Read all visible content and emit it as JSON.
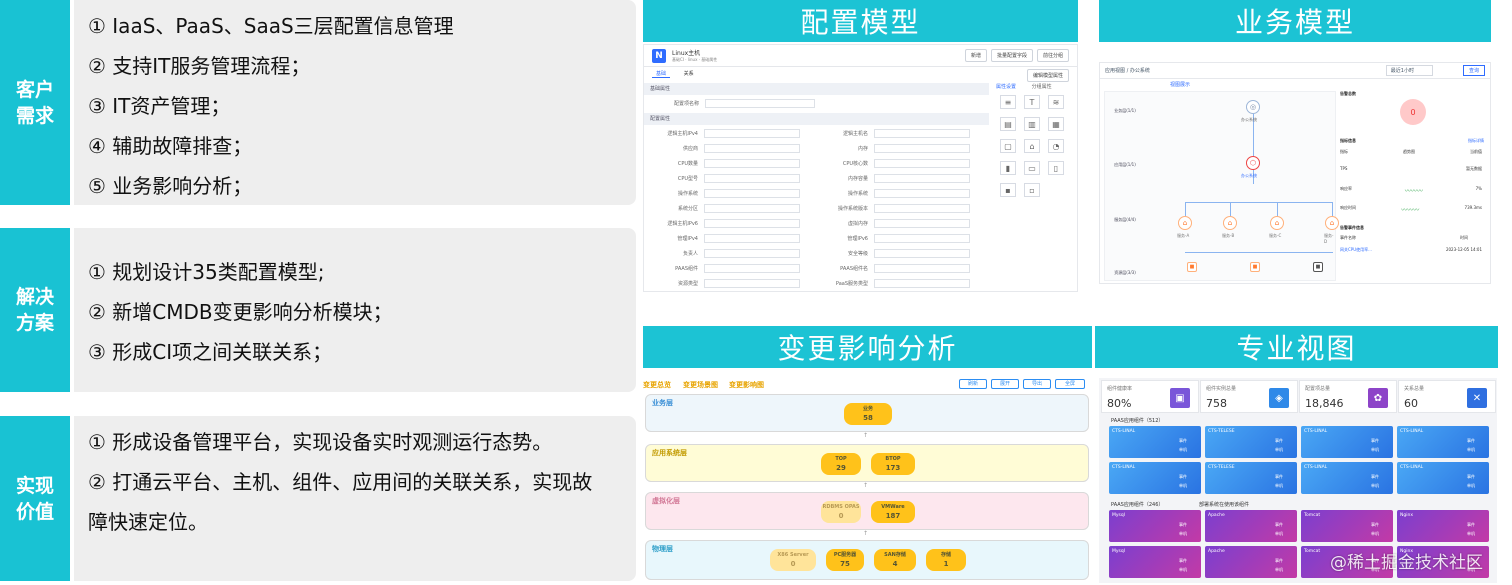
{
  "blocks": [
    {
      "label": "客户需求",
      "items": [
        "① IaaS、PaaS、SaaS三层配置信息管理",
        "② 支持IT服务管理流程；",
        "③ IT资产管理；",
        "④ 辅助故障排查；",
        "⑤ 业务影响分析；"
      ]
    },
    {
      "label": "解决方案",
      "items": [
        "① 规划设计35类配置模型;",
        "② 新增CMDB变更影响分析模块；",
        "③ 形成CI项之间关联关系；"
      ]
    },
    {
      "label": "实现价值",
      "items": [
        "① 形成设备管理平台，实现设备实时观测运行态势。",
        "② 打通云平台、主机、组件、应用间的关联关系，实现故障快速定位。"
      ]
    }
  ],
  "panels": {
    "config_model": {
      "title": "配置模型",
      "app_title": "Linux主机",
      "breadcrumb": "基础CI · linux · 基础属性",
      "buttons": [
        "新增",
        "批量配置字段",
        "前往分组"
      ],
      "tabs": [
        "基础",
        "关系"
      ],
      "right_button": "编辑模型属性",
      "right_tabs": [
        "属性设置",
        "分组属性"
      ],
      "section_basic": "基础属性",
      "section_config": "配置属性",
      "field_name": "配置项名称",
      "fields_left": [
        "逻辑主机IPv4",
        "供应商",
        "CPU数量",
        "CPU型号",
        "操作系统",
        "系统分区",
        "逻辑主机IPv6",
        "管理IPv4",
        "负责人",
        "PAAS组件",
        "资源类型"
      ],
      "fields_right": [
        "逻辑主机名",
        "内存",
        "CPU核心数",
        "内存容量",
        "操作系统",
        "操作系统版本",
        "虚拟内存",
        "管理IPv6",
        "安全等级",
        "PAAS组件名",
        "PaaS服务类型"
      ]
    },
    "business_model": {
      "title": "业务模型",
      "breadcrumb": "应用视图 / 办公系统",
      "tab": "视图展示",
      "date_label": "最近1小时",
      "query_button": "查询",
      "lanes": [
        "业务层(1/1)",
        "应用层(1/1)",
        "服务层(4/4)",
        "资源层(3/3)"
      ],
      "top_node": "办公系统",
      "app_node": "办公系统",
      "service_nodes": [
        "服务-A",
        "服务-B",
        "服务-C",
        "服务-D"
      ],
      "alarm_title": "告警总数",
      "alarm_value": "0",
      "kpi_title": "指标信息",
      "kpi_link": "指标详情",
      "kpi_headers": [
        "指标",
        "趋势图",
        "当前值"
      ],
      "kpi_rows": [
        {
          "name": "TPS",
          "value": "暂无数据"
        },
        {
          "name": "响应率",
          "value": "7%"
        },
        {
          "name": "响应时间",
          "value": "739.3ms"
        }
      ],
      "event_title": "告警事件信息",
      "event_headers": [
        "事件名称",
        "",
        "时间"
      ],
      "event_row": {
        "name": "网关CPU使用率...",
        "time": "2023-12-05 14:01"
      }
    },
    "change_impact": {
      "title": "变更影响分析",
      "tabs": [
        "变更总览",
        "变更场景图",
        "变更影响图"
      ],
      "tool_buttons": [
        "刷新",
        "展开",
        "导出",
        "全屏"
      ],
      "layers": [
        {
          "name": "业务层",
          "color": "#eef6fb",
          "title_color": "#3a8fd6",
          "nodes": [
            {
              "label": "业务",
              "value": "58"
            }
          ]
        },
        {
          "name": "应用系统层",
          "color": "#fffcd6",
          "title_color": "#c29a00",
          "nodes": [
            {
              "label": "TOP",
              "value": "29"
            },
            {
              "label": "BTOP",
              "value": "173"
            }
          ]
        },
        {
          "name": "虚拟化层",
          "color": "#fde7ee",
          "title_color": "#d27896",
          "nodes": [
            {
              "label": "RDBMS OPAS",
              "value": "0"
            },
            {
              "label": "VMWare",
              "value": "187"
            }
          ]
        },
        {
          "name": "物理层",
          "color": "#e8f7fc",
          "title_color": "#2f9fc9",
          "nodes": [
            {
              "label": "X86 Server",
              "value": "0"
            },
            {
              "label": "PC服务器",
              "value": "75"
            },
            {
              "label": "SAN存储",
              "value": "4"
            },
            {
              "label": "存储",
              "value": "1"
            }
          ]
        }
      ]
    },
    "pro_view": {
      "title": "专业视图",
      "cards": [
        {
          "label": "组件健康率",
          "value": "80%",
          "icon": "briefcase-icon",
          "color": "#7a56d9"
        },
        {
          "label": "组件实例总量",
          "value": "758",
          "icon": "cube-icon",
          "color": "#2f89e8"
        },
        {
          "label": "配置项总量",
          "value": "18,846",
          "icon": "gear-icon",
          "color": "#8d44c8"
        },
        {
          "label": "关系总量",
          "value": "60",
          "icon": "network-icon",
          "color": "#2f6fe0"
        }
      ],
      "section1": "PAAS应用组件（512）",
      "section2_left": "PAAS应用组件（246）",
      "section2_right": "部署系统在使用该组件",
      "blue_tiles": [
        "CTS-LINAL",
        "CTS-TELESE",
        "CTS-LINAL",
        "CTS-LINAL",
        "CTS-LINAL",
        "CTS-TELESE",
        "CTS-LINAL",
        "CTS-LINAL"
      ],
      "purple_tiles": [
        "Mysql",
        "Apache",
        "Tomcat",
        "Nginx",
        "Mysql",
        "Apache",
        "Tomcat",
        "Nginx"
      ],
      "tile_meta": [
        "事件",
        "单机"
      ],
      "watermark": "@稀土掘金技术社区"
    }
  }
}
